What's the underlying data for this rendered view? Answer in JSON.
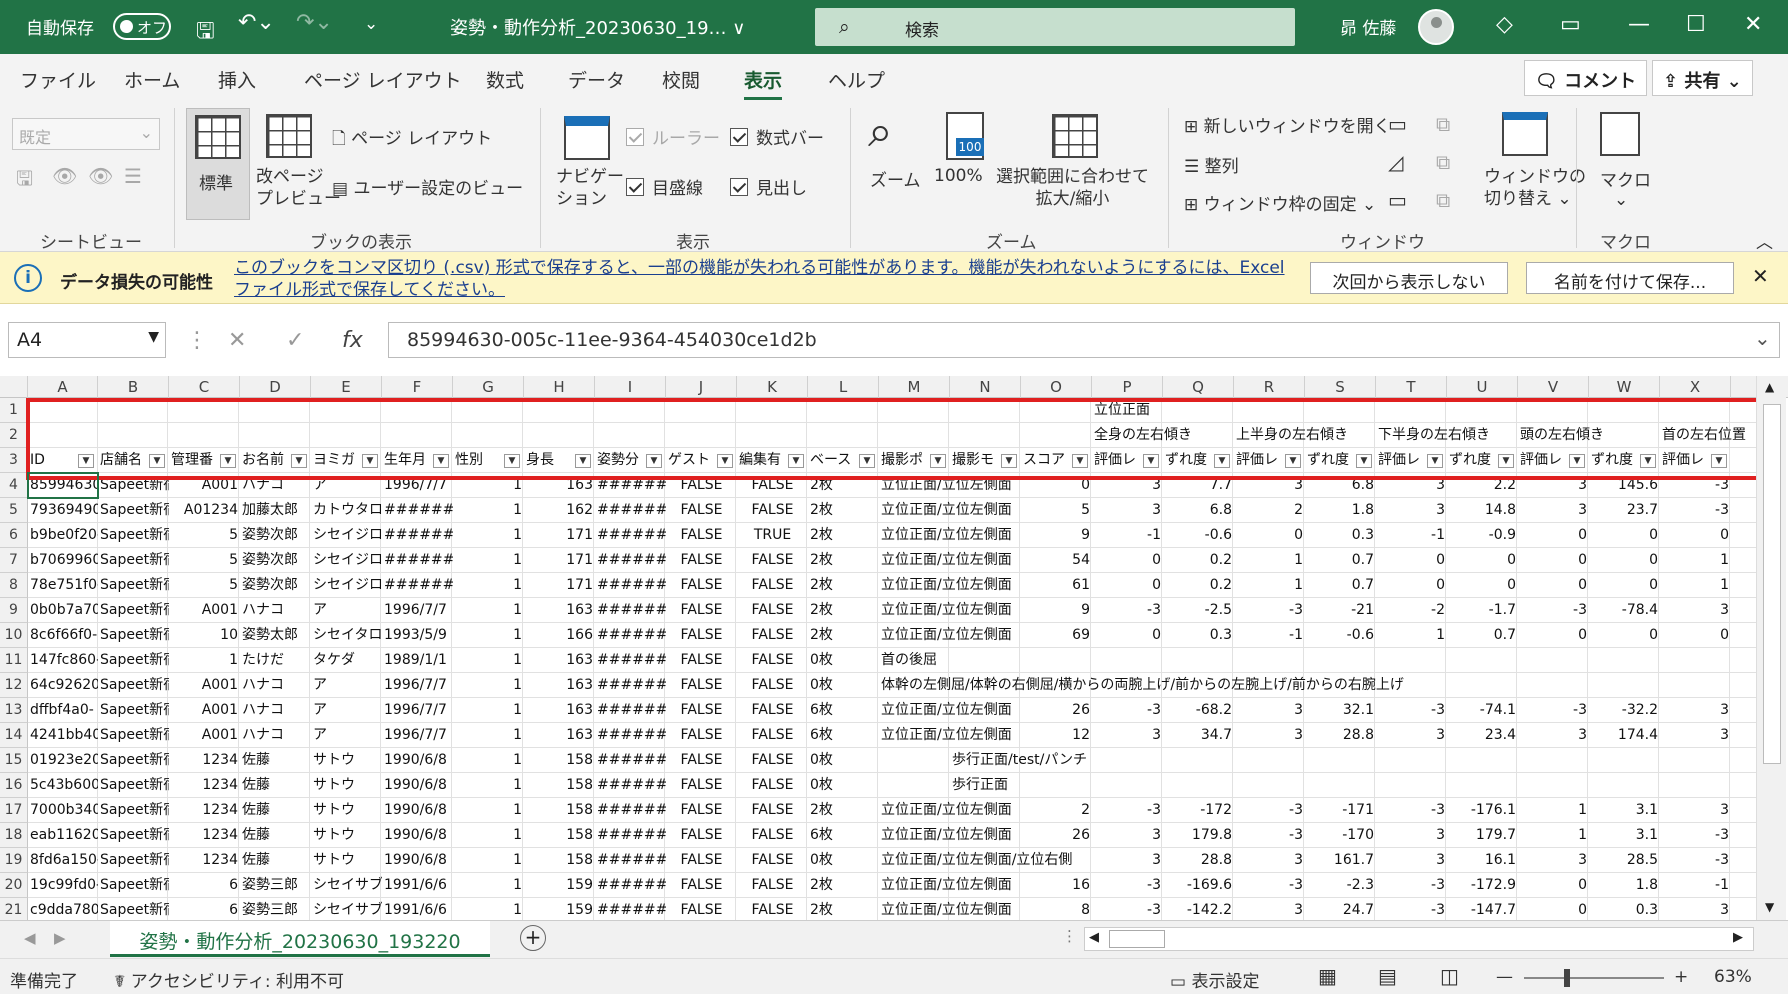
{
  "titlebar": {
    "autosave_label": "自動保存",
    "autosave_state": "オフ",
    "filename": "姿勢・動作分析_20230630_19… ∨",
    "search_placeholder": "検索",
    "user": "昴 佐藤"
  },
  "menu": {
    "tabs": [
      "ファイル",
      "ホーム",
      "挿入",
      "ページ レイアウト",
      "数式",
      "データ",
      "校閲",
      "表示",
      "ヘルプ"
    ],
    "active": "表示",
    "comment_label": "コメント",
    "share_label": "共有"
  },
  "ribbon": {
    "sheetview": {
      "dropdown": "既定",
      "group": "シートビュー"
    },
    "bookview": {
      "normal": "標準",
      "pagebreak": "改ページ\nプレビュー",
      "pagelayout": "ページ レイアウト",
      "custom": "ユーザー設定のビュー",
      "group": "ブックの表示"
    },
    "show": {
      "navigation": "ナビゲー\nション",
      "ruler": "ルーラー",
      "formulabar": "数式バー",
      "gridlines": "目盛線",
      "headings": "見出し",
      "group": "表示"
    },
    "zoom": {
      "zoom": "ズーム",
      "hundred": "100%",
      "fit": "選択範囲に合わせて\n拡大/縮小",
      "group": "ズーム"
    },
    "window": {
      "newwin": "新しいウィンドウを開く",
      "arrange": "整列",
      "freeze": "ウィンドウ枠の固定 ⌄",
      "switch": "ウィンドウの\n切り替え ⌄",
      "group": "ウィンドウ"
    },
    "macro": {
      "label": "マクロ",
      "group": "マクロ"
    }
  },
  "notice": {
    "title": "データ損失の可能性",
    "message": "このブックをコンマ区切り (.csv) 形式で保存すると、一部の機能が失われる可能性があります。機能が失われないようにするには、Excel ファイル形式で保存してください。",
    "btn_dismiss": "次回から表示しない",
    "btn_saveas": "名前を付けて保存..."
  },
  "formula_bar": {
    "cell_ref": "A4",
    "content": "85994630-005c-11ee-9364-454030ce1d2b"
  },
  "columns": [
    "A",
    "B",
    "C",
    "D",
    "E",
    "F",
    "G",
    "H",
    "I",
    "J",
    "K",
    "L",
    "M",
    "N",
    "O",
    "P",
    "Q",
    "R",
    "S",
    "T",
    "U",
    "V",
    "W",
    "X"
  ],
  "header_row1": {
    "P": "立位正面"
  },
  "header_row2": {
    "P": "全身の左右傾き",
    "R": "上半身の左右傾き",
    "T": "下半身の左右傾き",
    "V": "頭の左右傾き",
    "X": "首の左右位置"
  },
  "header_row3": [
    "ID",
    "店舗名",
    "管理番",
    "お名前",
    "ヨミガ",
    "生年月",
    "性別",
    "身長",
    "姿勢分",
    "ゲスト",
    "編集有",
    "ベース",
    "撮影ポ",
    "撮影モ",
    "スコア",
    "評価レ",
    "ずれ度",
    "評価レ",
    "ずれ度",
    "評価レ",
    "ずれ度",
    "評価レ",
    "ずれ度",
    "評価レ"
  ],
  "rows": [
    {
      "n": "4",
      "v": [
        "85994630",
        "Sapeet新宿",
        "A001",
        "ハナコ",
        "ア",
        "1996/7/7",
        "1",
        "163",
        "#######",
        "FALSE",
        "FALSE",
        "2枚",
        "立位正面/立位左側面",
        "",
        "0",
        "3",
        "7.7",
        "3",
        "6.8",
        "3",
        "2.2",
        "3",
        "145.6",
        "-3"
      ]
    },
    {
      "n": "5",
      "v": [
        "79369490",
        "Sapeet新宿",
        "A01234",
        "加藤太郎",
        "カトウタロ",
        "#######",
        "1",
        "162",
        "#######",
        "FALSE",
        "FALSE",
        "2枚",
        "立位正面/立位左側面",
        "",
        "5",
        "3",
        "6.8",
        "2",
        "1.8",
        "3",
        "14.8",
        "3",
        "23.7",
        "-3"
      ]
    },
    {
      "n": "6",
      "v": [
        "b9be0f20-",
        "Sapeet新宿",
        "5",
        "姿勢次郎",
        "シセイジロ",
        "#######",
        "1",
        "171",
        "#######",
        "FALSE",
        "TRUE",
        "2枚",
        "立位正面/立位左側面",
        "",
        "9",
        "-1",
        "-0.6",
        "0",
        "0.3",
        "-1",
        "-0.9",
        "0",
        "0",
        "0"
      ]
    },
    {
      "n": "7",
      "v": [
        "b7069960",
        "Sapeet新宿",
        "5",
        "姿勢次郎",
        "シセイジロ",
        "#######",
        "1",
        "171",
        "#######",
        "FALSE",
        "FALSE",
        "2枚",
        "立位正面/立位左側面",
        "",
        "54",
        "0",
        "0.2",
        "1",
        "0.7",
        "0",
        "0",
        "0",
        "0",
        "1"
      ]
    },
    {
      "n": "8",
      "v": [
        "78e751f0-",
        "Sapeet新宿",
        "5",
        "姿勢次郎",
        "シセイジロ",
        "#######",
        "1",
        "171",
        "#######",
        "FALSE",
        "FALSE",
        "2枚",
        "立位正面/立位左側面",
        "",
        "61",
        "0",
        "0.2",
        "1",
        "0.7",
        "0",
        "0",
        "0",
        "0",
        "1"
      ]
    },
    {
      "n": "9",
      "v": [
        "0b0b7a70",
        "Sapeet新宿",
        "A001",
        "ハナコ",
        "ア",
        "1996/7/7",
        "1",
        "163",
        "#######",
        "FALSE",
        "FALSE",
        "2枚",
        "立位正面/立位左側面",
        "",
        "9",
        "-3",
        "-2.5",
        "-3",
        "-21",
        "-2",
        "-1.7",
        "-3",
        "-78.4",
        "3"
      ]
    },
    {
      "n": "10",
      "v": [
        "8c6f66f0-",
        "Sapeet新宿",
        "10",
        "姿勢太郎",
        "シセイタロ",
        "1993/5/9",
        "1",
        "166",
        "#######",
        "FALSE",
        "FALSE",
        "2枚",
        "立位正面/立位左側面",
        "",
        "69",
        "0",
        "0.3",
        "-1",
        "-0.6",
        "1",
        "0.7",
        "0",
        "0",
        "0"
      ]
    },
    {
      "n": "11",
      "v": [
        "147fc860-",
        "Sapeet新宿",
        "1",
        "たけだ",
        "タケダ",
        "1989/1/1",
        "1",
        "163",
        "#######",
        "FALSE",
        "FALSE",
        "0枚",
        "首の後屈",
        "",
        "",
        "",
        "",
        "",
        "",
        "",
        "",
        "",
        "",
        ""
      ]
    },
    {
      "n": "12",
      "v": [
        "64c92620",
        "Sapeet新宿",
        "A001",
        "ハナコ",
        "ア",
        "1996/7/7",
        "1",
        "163",
        "#######",
        "FALSE",
        "FALSE",
        "0枚",
        "体幹の左側屈/体幹の右側屈/横からの両腕上げ/前からの左腕上げ/前からの右腕上げ",
        "",
        "",
        "",
        "",
        "",
        "",
        "",
        "",
        "",
        "",
        ""
      ]
    },
    {
      "n": "13",
      "v": [
        "dffbf4a0-",
        "Sapeet新宿",
        "A001",
        "ハナコ",
        "ア",
        "1996/7/7",
        "1",
        "163",
        "#######",
        "FALSE",
        "FALSE",
        "6枚",
        "立位正面/立位左側面",
        "",
        "26",
        "-3",
        "-68.2",
        "3",
        "32.1",
        "-3",
        "-74.1",
        "-3",
        "-32.2",
        "3"
      ]
    },
    {
      "n": "14",
      "v": [
        "4241bb40",
        "Sapeet新宿",
        "A001",
        "ハナコ",
        "ア",
        "1996/7/7",
        "1",
        "163",
        "#######",
        "FALSE",
        "FALSE",
        "6枚",
        "立位正面/立位左側面",
        "",
        "12",
        "3",
        "34.7",
        "3",
        "28.8",
        "3",
        "23.4",
        "3",
        "174.4",
        "3"
      ]
    },
    {
      "n": "15",
      "v": [
        "01923e20",
        "Sapeet新宿",
        "1234",
        "佐藤",
        "サトウ",
        "1990/6/8",
        "1",
        "158",
        "#######",
        "FALSE",
        "FALSE",
        "0枚",
        "",
        "歩行正面/test/パンチ",
        "",
        "",
        "",
        "",
        "",
        "",
        "",
        "",
        "",
        ""
      ]
    },
    {
      "n": "16",
      "v": [
        "5c43b600",
        "Sapeet新宿",
        "1234",
        "佐藤",
        "サトウ",
        "1990/6/8",
        "1",
        "158",
        "#######",
        "FALSE",
        "FALSE",
        "0枚",
        "",
        "歩行正面",
        "",
        "",
        "",
        "",
        "",
        "",
        "",
        "",
        "",
        ""
      ]
    },
    {
      "n": "17",
      "v": [
        "7000b340",
        "Sapeet新宿",
        "1234",
        "佐藤",
        "サトウ",
        "1990/6/8",
        "1",
        "158",
        "#######",
        "FALSE",
        "FALSE",
        "2枚",
        "立位正面/立位左側面",
        "",
        "2",
        "-3",
        "-172",
        "-3",
        "-171",
        "-3",
        "-176.1",
        "1",
        "3.1",
        "3"
      ]
    },
    {
      "n": "18",
      "v": [
        "eab11620",
        "Sapeet新宿",
        "1234",
        "佐藤",
        "サトウ",
        "1990/6/8",
        "1",
        "158",
        "#######",
        "FALSE",
        "FALSE",
        "6枚",
        "立位正面/立位左側面",
        "",
        "26",
        "3",
        "179.8",
        "-3",
        "-170",
        "3",
        "179.7",
        "1",
        "3.1",
        "-3"
      ]
    },
    {
      "n": "19",
      "v": [
        "8fd6a150-",
        "Sapeet新宿",
        "1234",
        "佐藤",
        "サトウ",
        "1990/6/8",
        "1",
        "158",
        "#######",
        "FALSE",
        "FALSE",
        "0枚",
        "立位正面/立位左側面/立位右側",
        "",
        "",
        "3",
        "28.8",
        "3",
        "161.7",
        "3",
        "16.1",
        "3",
        "28.5",
        "-3"
      ]
    },
    {
      "n": "20",
      "v": [
        "19c99fd0-",
        "Sapeet新宿",
        "6",
        "姿勢三郎",
        "シセイサブ",
        "1991/6/6",
        "1",
        "159",
        "#######",
        "FALSE",
        "FALSE",
        "2枚",
        "立位正面/立位左側面",
        "",
        "16",
        "-3",
        "-169.6",
        "-3",
        "-2.3",
        "-3",
        "-172.9",
        "0",
        "1.8",
        "-1"
      ]
    },
    {
      "n": "21",
      "v": [
        "c9dda780",
        "Sapeet新宿",
        "6",
        "姿勢三郎",
        "シセイサブ",
        "1991/6/6",
        "1",
        "159",
        "#######",
        "FALSE",
        "FALSE",
        "2枚",
        "立位正面/立位左側面",
        "",
        "8",
        "-3",
        "-142.2",
        "3",
        "24.7",
        "-3",
        "-147.7",
        "0",
        "0.3",
        "3"
      ]
    }
  ],
  "sheet_tab": "姿勢・動作分析_20230630_193220",
  "status": {
    "ready": "準備完了",
    "accessibility": "アクセシビリティ: 利用不可",
    "display_settings": "表示設定",
    "zoom": "63%"
  }
}
